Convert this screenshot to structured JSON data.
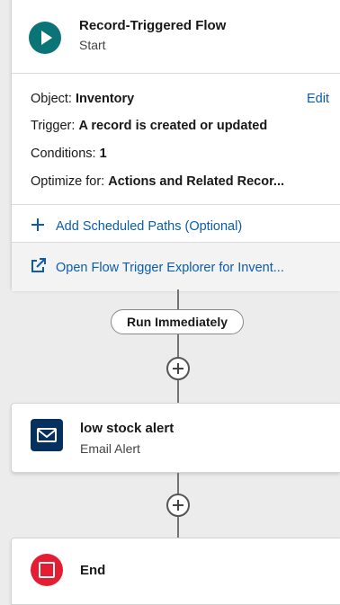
{
  "start_node": {
    "title": "Record-Triggered Flow",
    "subtitle": "Start",
    "icon": "play-icon",
    "icon_color": "#0b7477",
    "object_label": "Object:",
    "object_value": "Inventory",
    "edit_label": "Edit",
    "trigger_label": "Trigger:",
    "trigger_value": "A record is created or updated",
    "conditions_label": "Conditions:",
    "conditions_value": "1",
    "optimize_label": "Optimize for:",
    "optimize_value": "Actions and Related Recor...",
    "add_paths_label": "Add Scheduled Paths (Optional)",
    "trigger_explorer_label": "Open Flow Trigger Explorer for Invent..."
  },
  "path": {
    "run_label": "Run Immediately"
  },
  "email_node": {
    "title": "low stock alert",
    "subtitle": "Email Alert",
    "icon": "envelope-icon",
    "icon_color": "#06315f"
  },
  "end_node": {
    "title": "End",
    "icon": "stop-icon",
    "icon_color": "#e41d33"
  },
  "colors": {
    "link": "#0b5cab",
    "canvas": "#ececec",
    "connector": "#747474"
  }
}
